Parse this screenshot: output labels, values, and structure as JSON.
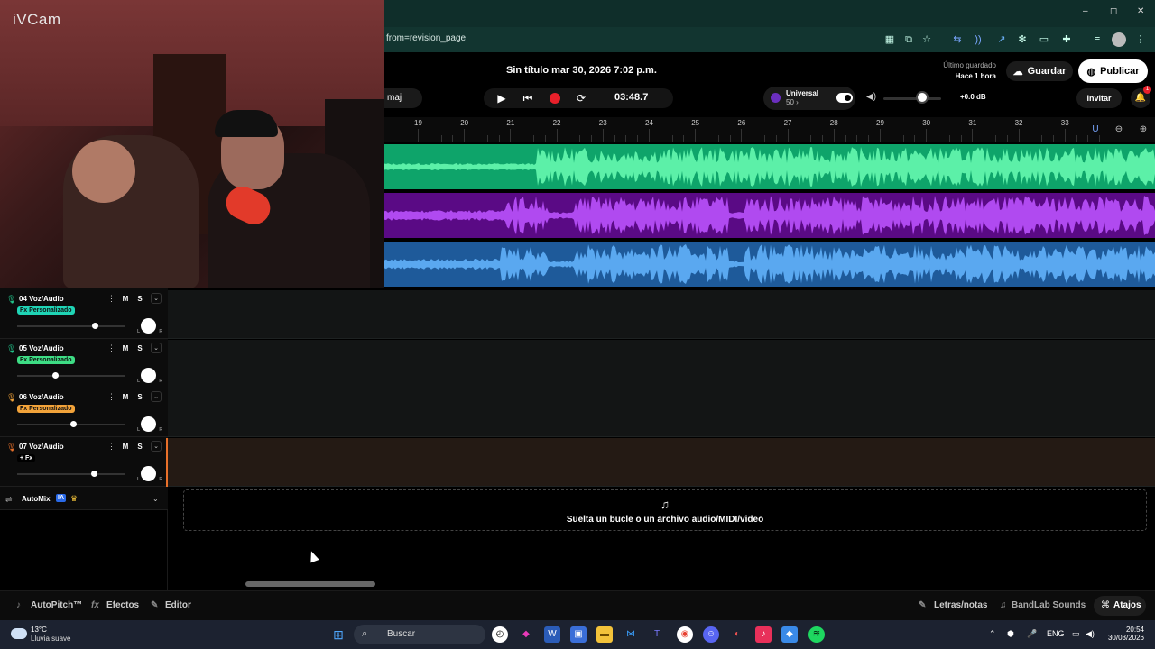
{
  "webcam": {
    "overlay_text": "iVCam"
  },
  "browser": {
    "url": "from=revision_page",
    "window_controls": {
      "minimize": "–",
      "maximize": "◻",
      "close": "✕"
    },
    "extensions": [
      "qr-icon",
      "pip-icon",
      "star-icon",
      "translate-icon",
      "audio-icon",
      "ext-icon",
      "gear-icon",
      "cast-icon",
      "puzzle-icon",
      "queue-icon",
      "profile-icon",
      "menu-icon"
    ]
  },
  "daw": {
    "project_title": "Sin título mar 30, 2026 7:02 p.m.",
    "last_saved_label": "Último guardado",
    "last_saved_value": "Hace 1 hora",
    "save_label": "Guardar",
    "publish_label": "Publicar",
    "key_label": "maj",
    "timecode": "03:48.7",
    "universal_name": "Universal",
    "universal_value": "50 ›",
    "volume_db": "+0.0 dB",
    "invite_label": "Invitar",
    "notification_count": "1",
    "ruler_ticks": [
      "19",
      "20",
      "21",
      "22",
      "23",
      "24",
      "25",
      "26",
      "27",
      "28",
      "29",
      "30",
      "31",
      "32",
      "33"
    ],
    "tracks": [
      {
        "name": "04  Voz/Audio",
        "fx": "Fx Personalizado",
        "fx_color": "#1fd4b5",
        "mic_color": "#22c48a",
        "volume": 0.72
      },
      {
        "name": "05  Voz/Audio",
        "fx": "Fx Personalizado",
        "fx_color": "#3ddc84",
        "mic_color": "#22c48a",
        "volume": 0.35
      },
      {
        "name": "06  Voz/Audio",
        "fx": "Fx Personalizado",
        "fx_color": "#f2a33a",
        "mic_color": "#f2a33a",
        "volume": 0.52
      },
      {
        "name": "07  Voz/Audio",
        "fx": "+ Fx",
        "fx_color": "#000000",
        "mic_color": "#e8702a",
        "volume": 0.71
      }
    ],
    "mute_label": "M",
    "solo_label": "S",
    "pan_l": "L",
    "pan_r": "R",
    "automix_label": "AutoMix",
    "automix_badge": "IA",
    "drop_text": "Suelta un bucle o un archivo audio/MIDI/video",
    "bottom_left": [
      "AutoPitch™",
      "Efectos",
      "Editor"
    ],
    "bottom_right": [
      "Letras/notas",
      "BandLab Sounds",
      "Atajos"
    ]
  },
  "taskbar": {
    "temperature": "13°C",
    "weather": "Lluvia suave",
    "search_placeholder": "Buscar",
    "language": "ENG",
    "time": "20:54",
    "date": "30/03/2026"
  },
  "colors": {
    "wave1": "#0ea46a",
    "wave2": "#5a0a85",
    "wave3": "#1e5a9a",
    "accent": "#e8702a"
  }
}
